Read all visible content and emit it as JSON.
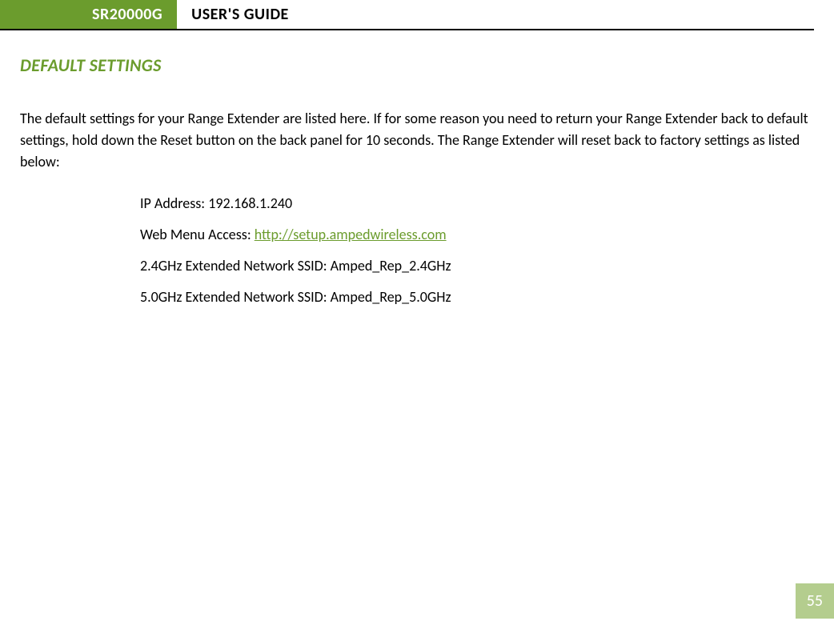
{
  "header": {
    "product_code": "SR20000G",
    "doc_title": "USER'S GUIDE"
  },
  "section": {
    "title": "DEFAULT SETTINGS",
    "intro": "The default settings for your Range Extender are listed here. If for some reason you need to return your Range Extender back to default settings, hold down the Reset button on the back panel for 10 seconds. The Range Extender will reset back to factory settings as listed below:"
  },
  "settings": {
    "ip": {
      "label": "IP Address:  ",
      "value": "192.168.1.240"
    },
    "web": {
      "label": "Web Menu Access:  ",
      "value": "http://setup.ampedwireless.com"
    },
    "ssid24": {
      "label": "2.4GHz Extended Network SSID:  ",
      "value": "Amped_Rep_2.4GHz"
    },
    "ssid50": {
      "label": "5.0GHz Extended Network SSID:  ",
      "value": "Amped_Rep_5.0GHz"
    }
  },
  "page": {
    "number": "55"
  }
}
